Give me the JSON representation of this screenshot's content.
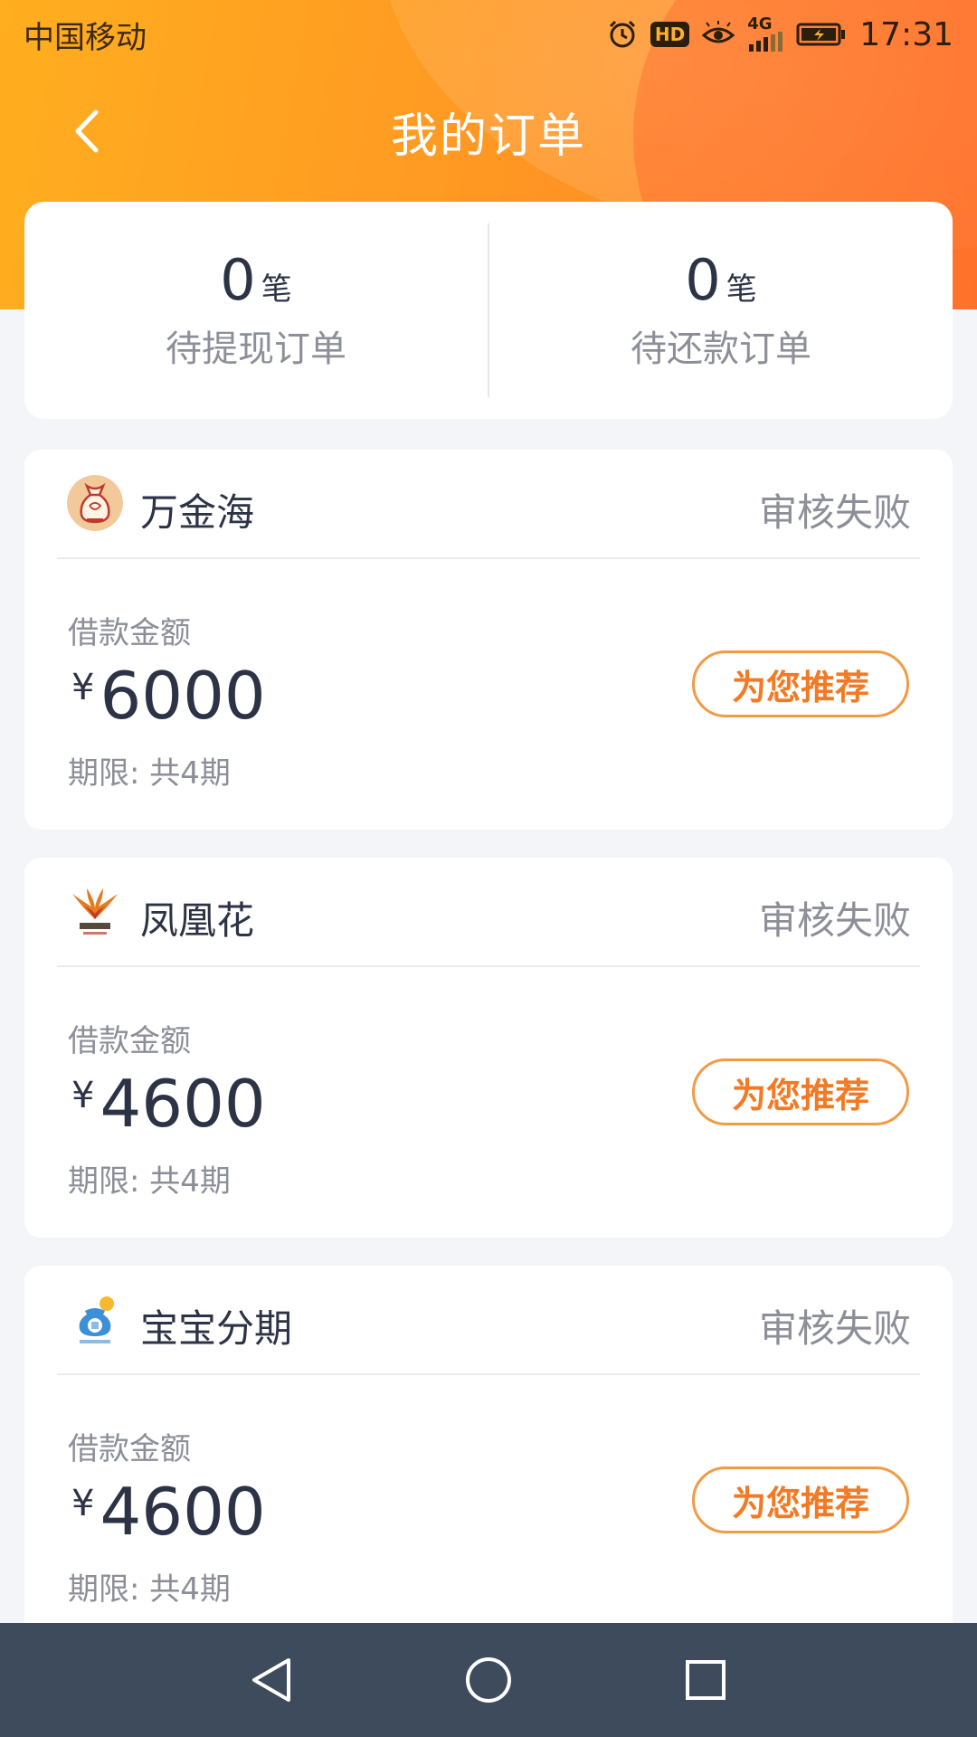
{
  "status_bar": {
    "carrier": "中国移动",
    "network": "4G",
    "hd": "HD",
    "time": "17:31",
    "icons": [
      "alarm-icon",
      "hd-icon",
      "eye-icon",
      "signal-icon",
      "battery-icon"
    ]
  },
  "header": {
    "title": "我的订单",
    "back_icon": "chevron-left-icon",
    "gradient_colors": [
      "#ffae1f",
      "#ff7f2a"
    ]
  },
  "summary": {
    "pending_withdraw": {
      "count": "0",
      "unit": "笔",
      "label": "待提现订单"
    },
    "pending_repay": {
      "count": "0",
      "unit": "笔",
      "label": "待还款订单"
    }
  },
  "orders": [
    {
      "app_name": "万金海",
      "status": "审核失败",
      "amount_label": "借款金额",
      "currency": "¥",
      "amount": "6000",
      "term": "期限: 共4期",
      "button": "为您推荐",
      "logo_icon": "money-bag-logo"
    },
    {
      "app_name": "凤凰花",
      "status": "审核失败",
      "amount_label": "借款金额",
      "currency": "¥",
      "amount": "4600",
      "term": "期限: 共4期",
      "button": "为您推荐",
      "logo_icon": "phoenix-logo"
    },
    {
      "app_name": "宝宝分期",
      "status": "审核失败",
      "amount_label": "借款金额",
      "currency": "¥",
      "amount": "4600",
      "term": "期限: 共4期",
      "button": "为您推荐",
      "logo_icon": "treasure-bag-logo"
    }
  ],
  "system_nav": {
    "icons": [
      "back-triangle-icon",
      "home-circle-icon",
      "recents-square-icon"
    ]
  },
  "colors": {
    "accent": "#f27a24",
    "text_primary": "#2d3346",
    "text_secondary": "#8c8f99",
    "nav_bg": "#3d4b5c"
  }
}
